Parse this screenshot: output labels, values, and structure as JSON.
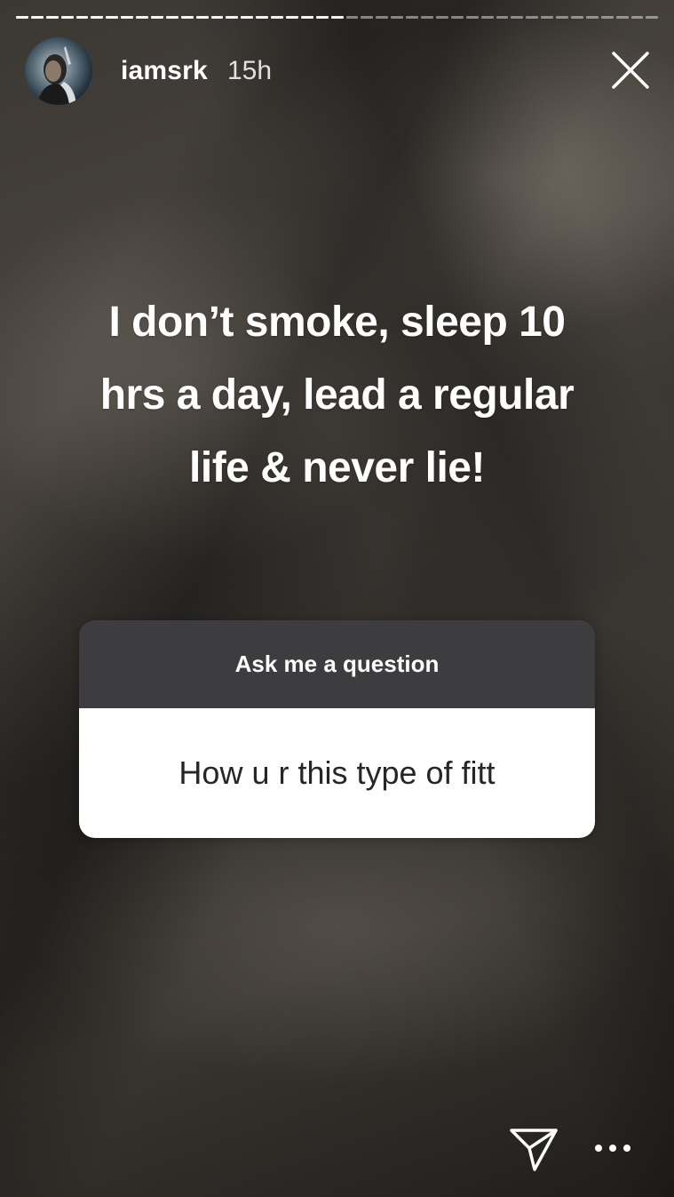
{
  "story": {
    "username": "iamsrk",
    "time_ago": "15h",
    "caption_lines": [
      "I don’t smoke, sleep 10",
      "hrs a day, lead a regular",
      "life & never lie!"
    ],
    "question_sticker": {
      "prompt": "Ask me a question",
      "answer": "How u r this type of fitt"
    }
  },
  "icons": {
    "close": "close-icon",
    "send": "send-icon",
    "more": "more-options-icon"
  },
  "colors": {
    "sticker_header": "#3d3d3f",
    "sticker_body": "#ffffff",
    "text_primary": "#ffffff"
  }
}
